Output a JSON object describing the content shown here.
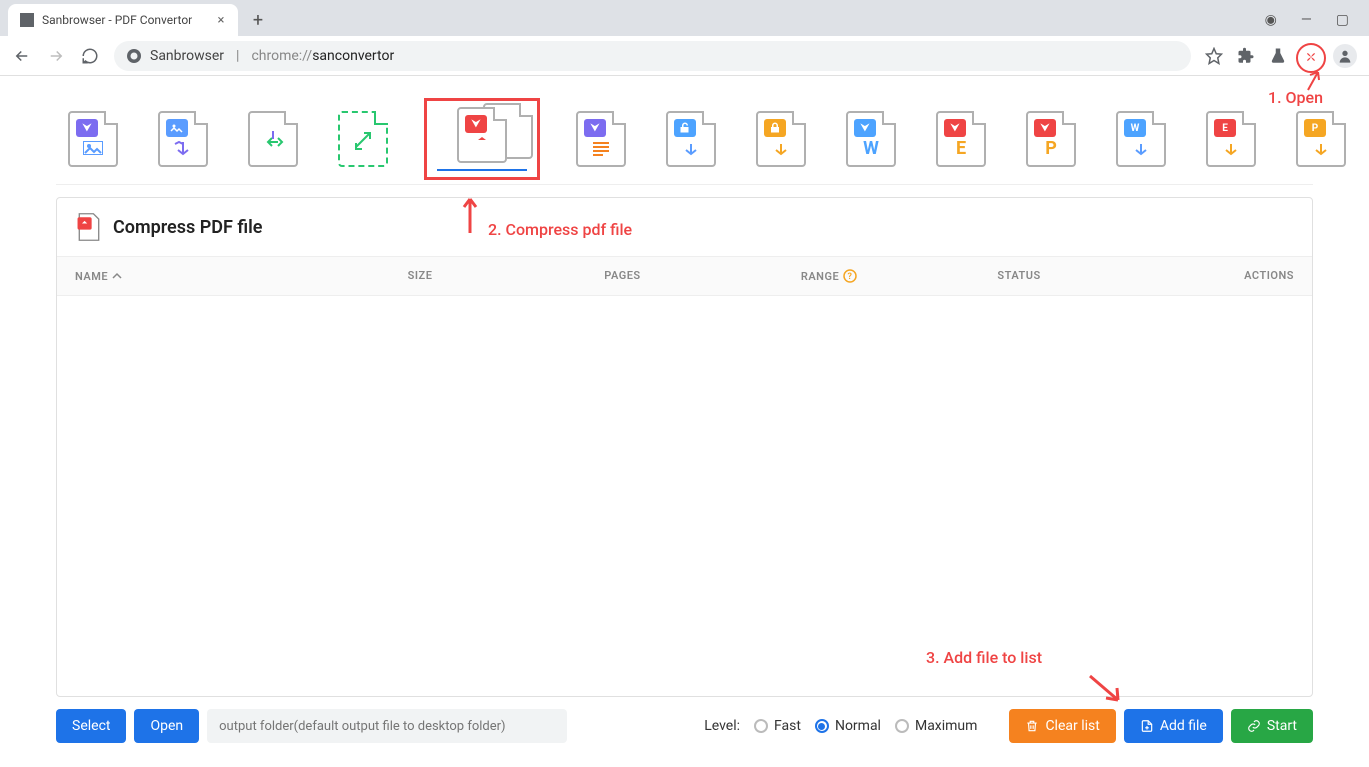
{
  "tab": {
    "title": "Sanbrowser - PDF Convertor"
  },
  "url": {
    "brand": "Sanbrowser",
    "prefix": "chrome://",
    "path": "sanconvertor"
  },
  "panel": {
    "title": "Compress PDF file"
  },
  "columns": {
    "name": "NAME",
    "size": "SIZE",
    "pages": "PAGES",
    "range": "RANGE",
    "status": "STATUS",
    "actions": "ACTIONS"
  },
  "footer": {
    "select": "Select",
    "open": "Open",
    "output_placeholder": "output folder(default output file to desktop folder)",
    "level_label": "Level:",
    "levels": {
      "fast": "Fast",
      "normal": "Normal",
      "maximum": "Maximum"
    },
    "clear": "Clear list",
    "add": "Add file",
    "start": "Start"
  },
  "annotations": {
    "open": "1. Open",
    "compress": "2. Compress pdf file",
    "addfile": "3. Add file to list"
  }
}
